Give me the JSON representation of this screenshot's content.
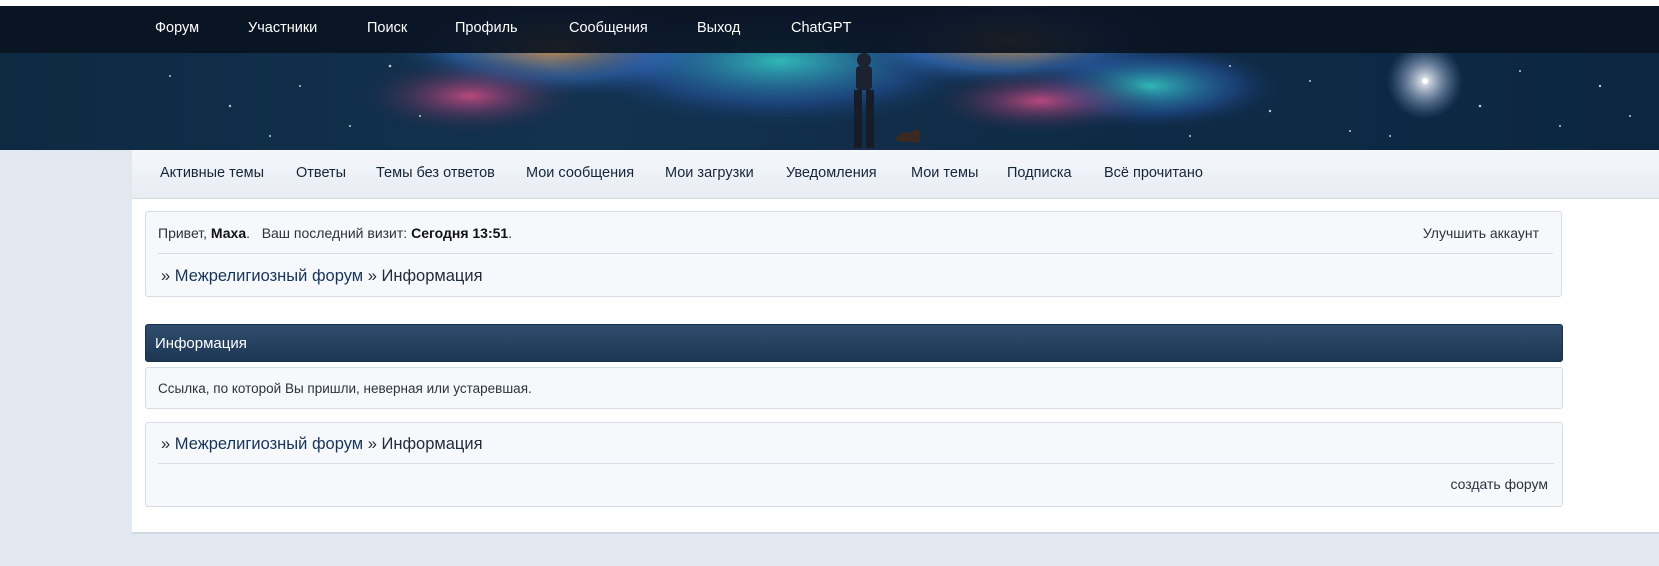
{
  "top_nav": {
    "items": [
      {
        "label": "Форум"
      },
      {
        "label": "Участники"
      },
      {
        "label": "Поиск"
      },
      {
        "label": "Профиль"
      },
      {
        "label": "Сообщения"
      },
      {
        "label": "Выход"
      },
      {
        "label": "ChatGPT"
      }
    ]
  },
  "sub_nav": {
    "items": [
      {
        "label": "Активные темы"
      },
      {
        "label": "Ответы"
      },
      {
        "label": "Темы без ответов"
      },
      {
        "label": "Мои сообщения"
      },
      {
        "label": "Мои загрузки"
      },
      {
        "label": "Уведомления"
      },
      {
        "label": "Мои темы"
      },
      {
        "label": "Подписка"
      },
      {
        "label": "Всё прочитано"
      }
    ]
  },
  "welcome": {
    "greeting": "Привет,",
    "username": "Маха",
    "period": ".",
    "last_visit_label": "Ваш последний визит:",
    "last_visit_value": "Сегодня 13:51",
    "upgrade_link": "Улучшить аккаунт"
  },
  "breadcrumb": {
    "prefix": "»",
    "forum": "Межрелигиозный форум",
    "separator": "»",
    "current": "Информация"
  },
  "info": {
    "title": "Информация",
    "message": "Ссылка, по которой Вы пришли, неверная или устаревшая."
  },
  "footer": {
    "create_forum": "создать форум"
  },
  "colors": {
    "header_bar": "#0a1422",
    "section_header": "#243f5c",
    "page_bg": "#e3e8f0"
  }
}
